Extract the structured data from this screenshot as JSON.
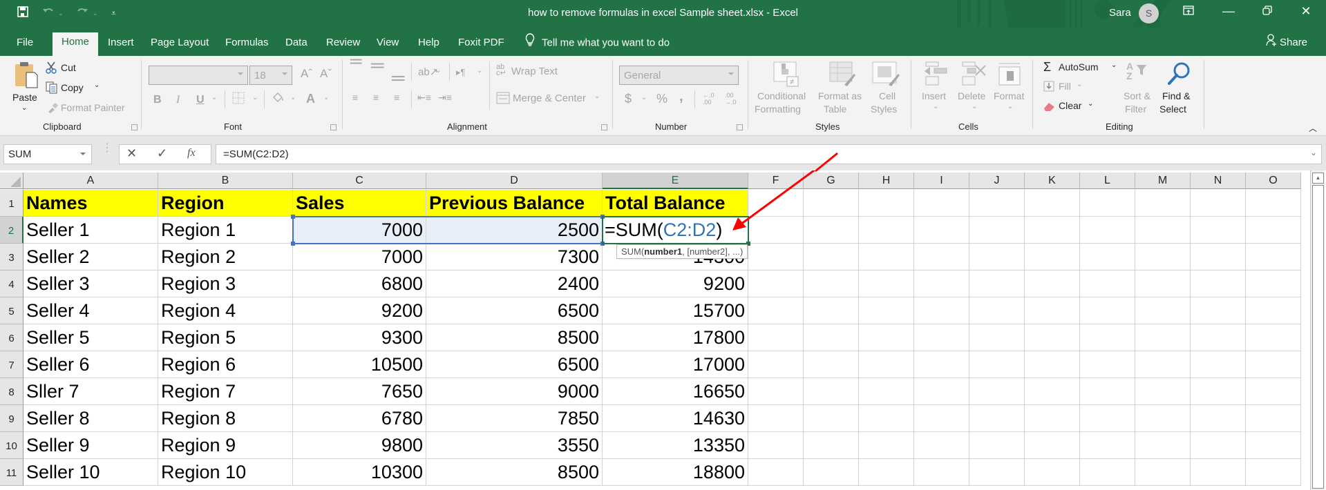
{
  "window": {
    "title": "how to remove formulas in excel Sample sheet.xlsx  -  Excel",
    "user_name": "Sara",
    "user_initial": "S",
    "accent_color": "#217346"
  },
  "quick_access": {
    "save_icon": "save-icon",
    "undo_icon": "undo-icon",
    "redo_icon": "redo-icon",
    "customize_icon": "customize-qat-icon"
  },
  "tabs": [
    {
      "label": "File"
    },
    {
      "label": "Home",
      "active": true
    },
    {
      "label": "Insert"
    },
    {
      "label": "Page Layout"
    },
    {
      "label": "Formulas"
    },
    {
      "label": "Data"
    },
    {
      "label": "Review"
    },
    {
      "label": "View"
    },
    {
      "label": "Help"
    },
    {
      "label": "Foxit PDF"
    }
  ],
  "tell_me": "Tell me what you want to do",
  "share_label": "Share",
  "ribbon": {
    "clipboard": {
      "group_label": "Clipboard",
      "paste": "Paste",
      "cut": "Cut",
      "copy": "Copy",
      "format_painter": "Format Painter"
    },
    "font": {
      "group_label": "Font",
      "font_name": "",
      "font_size": "18",
      "bold": "B",
      "italic": "I",
      "underline": "U",
      "font_color": "A"
    },
    "alignment": {
      "group_label": "Alignment",
      "wrap_text": "Wrap Text",
      "merge_center": "Merge & Center"
    },
    "number": {
      "group_label": "Number",
      "format": "General",
      "currency": "$",
      "percent": "%",
      "comma": ",",
      "inc_decimal": "←.0 .00",
      "dec_decimal": ".00 →.0"
    },
    "styles": {
      "group_label": "Styles",
      "conditional_formatting": [
        "Conditional",
        "Formatting"
      ],
      "format_as_table": [
        "Format as",
        "Table"
      ],
      "cell_styles": [
        "Cell",
        "Styles"
      ]
    },
    "cells": {
      "group_label": "Cells",
      "insert": "Insert",
      "delete": "Delete",
      "format": "Format"
    },
    "editing": {
      "group_label": "Editing",
      "autosum": "AutoSum",
      "fill": "Fill",
      "clear": "Clear",
      "sort_filter": [
        "Sort &",
        "Filter"
      ],
      "find_select": [
        "Find &",
        "Select"
      ]
    }
  },
  "formula_bar": {
    "name_box": "SUM",
    "cancel_icon": "✕",
    "enter_icon": "✓",
    "fx_label": "fx",
    "formula": "=SUM(C2:D2)"
  },
  "sheet": {
    "columns": [
      "A",
      "B",
      "C",
      "D",
      "E",
      "F",
      "G",
      "H",
      "I",
      "J",
      "K",
      "L",
      "M",
      "N",
      "O"
    ],
    "selected_column": "E",
    "rows": [
      "1",
      "2",
      "3",
      "4",
      "5",
      "6",
      "7",
      "8",
      "9",
      "10",
      "11"
    ],
    "selected_row": "2",
    "header_row": [
      "Names",
      "Region",
      "Sales",
      "Previous Balance",
      "Total Balance"
    ],
    "header_fill": "#ffff00",
    "data": [
      {
        "name": "Seller 1",
        "region": "Region 1",
        "sales": "7000",
        "prev": "2500",
        "total": "=SUM(C2:D2)"
      },
      {
        "name": "Seller 2",
        "region": "Region 2",
        "sales": "7000",
        "prev": "7300",
        "total": "14300"
      },
      {
        "name": "Seller 3",
        "region": "Region 3",
        "sales": "6800",
        "prev": "2400",
        "total": "9200"
      },
      {
        "name": "Seller 4",
        "region": "Region 4",
        "sales": "9200",
        "prev": "6500",
        "total": "15700"
      },
      {
        "name": "Seller 5",
        "region": "Region 5",
        "sales": "9300",
        "prev": "8500",
        "total": "17800"
      },
      {
        "name": "Seller 6",
        "region": "Region 6",
        "sales": "10500",
        "prev": "6500",
        "total": "17000"
      },
      {
        "name": "Sller 7",
        "region": "Region 7",
        "sales": "7650",
        "prev": "9000",
        "total": "16650"
      },
      {
        "name": "Seller 8",
        "region": "Region 8",
        "sales": "6780",
        "prev": "7850",
        "total": "14630"
      },
      {
        "name": "Seller 9",
        "region": "Region 9",
        "sales": "9800",
        "prev": "3550",
        "total": "13350"
      },
      {
        "name": "Seller 10",
        "region": "Region 10",
        "sales": "10300",
        "prev": "8500",
        "total": "18800"
      }
    ],
    "editing_formula": {
      "prefix": "=SUM(",
      "ref1": "C2",
      "colon": ":",
      "ref2": "D2",
      "suffix": ")",
      "ref_color": "#2f75b5"
    },
    "tooltip": {
      "fn": "SUM(",
      "arg1": "number1",
      "rest": ", [number2], ...)"
    },
    "annotation_arrow_color": "#ff0000"
  }
}
